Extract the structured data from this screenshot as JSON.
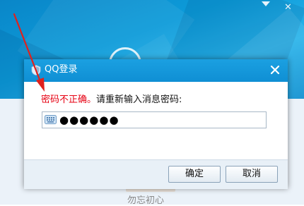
{
  "background_window": {
    "nickname": "勿忘初心",
    "minimize_icon": "triangle-down-icon",
    "close_icon": "close-icon",
    "close_glyph": "✕"
  },
  "dialog": {
    "title": "QQ登录",
    "title_icon": "qq-shield-icon",
    "close_icon": "close-icon",
    "message_error": "密码不正确。",
    "message_prompt": "请重新输入消息密码:",
    "password_value": "●●●●●●",
    "keyboard_icon": "keyboard-icon",
    "ok_label": "确定",
    "cancel_label": "取消"
  },
  "annotation": {
    "arrow_color": "#e0211d"
  },
  "colors": {
    "title_bar": "#1499dc",
    "error_text": "#e60012",
    "footer_bg": "#e8f0f7"
  }
}
